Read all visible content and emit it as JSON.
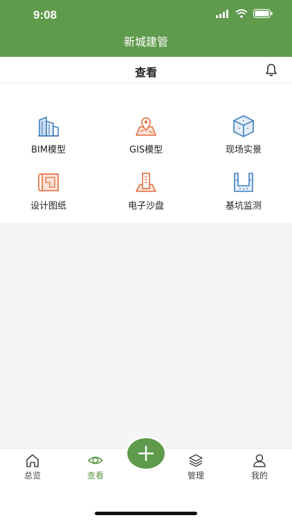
{
  "status": {
    "time": "9:08"
  },
  "app": {
    "title": "新城建管"
  },
  "nav": {
    "title": "查看"
  },
  "grid": [
    {
      "label": "BIM模型",
      "icon": "building-icon"
    },
    {
      "label": "GIS模型",
      "icon": "map-pin-icon"
    },
    {
      "label": "现场实景",
      "icon": "cube-icon"
    },
    {
      "label": "设计图纸",
      "icon": "blueprint-icon"
    },
    {
      "label": "电子沙盘",
      "icon": "sandbox-icon"
    },
    {
      "label": "基坑监测",
      "icon": "foundation-pit-icon"
    }
  ],
  "tabs": [
    {
      "label": "总览",
      "icon": "home-icon"
    },
    {
      "label": "查看",
      "icon": "eye-icon",
      "active": true
    },
    {
      "label": "管理",
      "icon": "layers-icon"
    },
    {
      "label": "我的",
      "icon": "user-icon"
    }
  ],
  "colors": {
    "brand": "#5f9a4d",
    "icon_blue": "#3f7fc1",
    "icon_orange": "#e06a3a"
  }
}
